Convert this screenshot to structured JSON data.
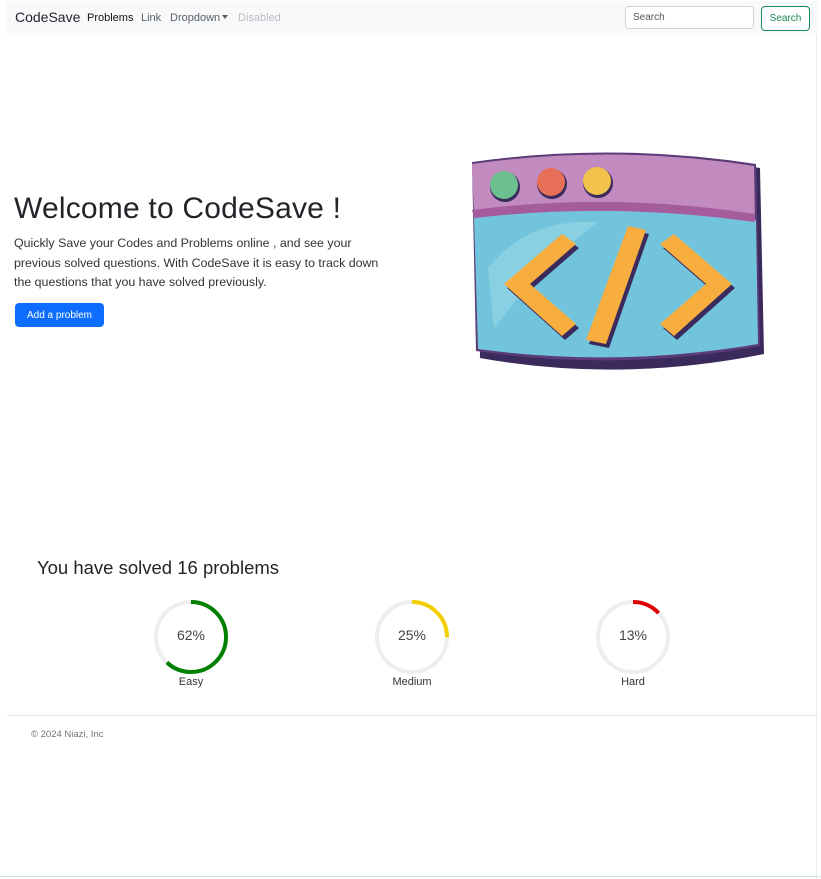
{
  "navbar": {
    "brand": "CodeSave",
    "links": [
      "Problems",
      "Link",
      "Dropdown",
      "Disabled"
    ],
    "search_placeholder": "Search",
    "search_button": "Search"
  },
  "hero": {
    "title": "Welcome to CodeSave !",
    "text": "Quickly Save your Codes and Problems online , and see your previous solved questions. With CodeSave it is easy to track down the questions that you have solved previously.",
    "button": "Add a problem",
    "illustration_icon": "code-window-icon"
  },
  "stats": {
    "title": "You have solved 16 problems",
    "items": [
      {
        "label": "Easy",
        "percent_text": "62%",
        "percent": 62,
        "color": "#008000"
      },
      {
        "label": "Medium",
        "percent_text": "25%",
        "percent": 25,
        "color": "#f2cf00"
      },
      {
        "label": "Hard",
        "percent_text": "13%",
        "percent": 13,
        "color": "#e00000"
      }
    ]
  },
  "footer": {
    "text": "© 2024 Niazi, Inc"
  },
  "colors": {
    "primary": "#0d6efd",
    "success": "#198754",
    "navbar_bg": "#f8f9fa"
  }
}
